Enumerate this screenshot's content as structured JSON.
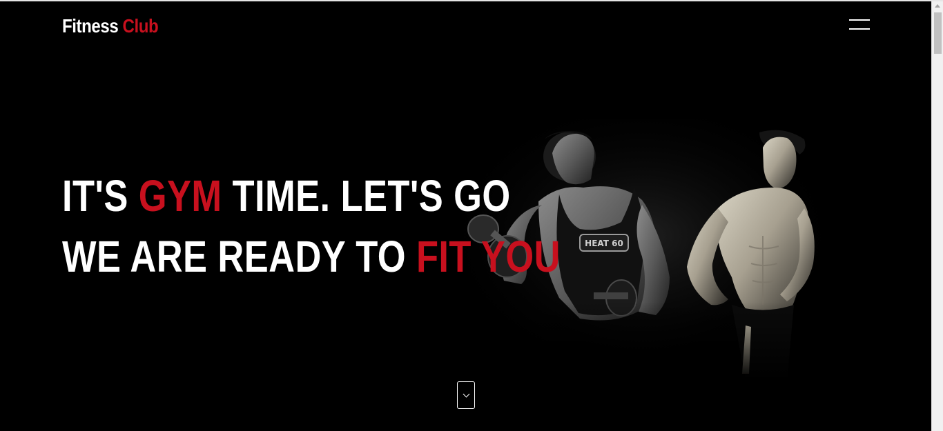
{
  "header": {
    "logo_primary": "Fitness",
    "logo_accent": "Club",
    "menu_icon": "hamburger-menu-icon"
  },
  "hero": {
    "line1_a": "IT'S ",
    "line1_red": "GYM",
    "line1_b": " TIME. LET'S GO",
    "line2_a": "WE ARE READY TO ",
    "line2_red": "FIT YOU",
    "image": "two-muscular-men-bodybuilders-photo",
    "scroll_icon": "chevron-down-icon"
  },
  "colors": {
    "background": "#000000",
    "accent": "#c8101e",
    "text": "#ffffff"
  }
}
